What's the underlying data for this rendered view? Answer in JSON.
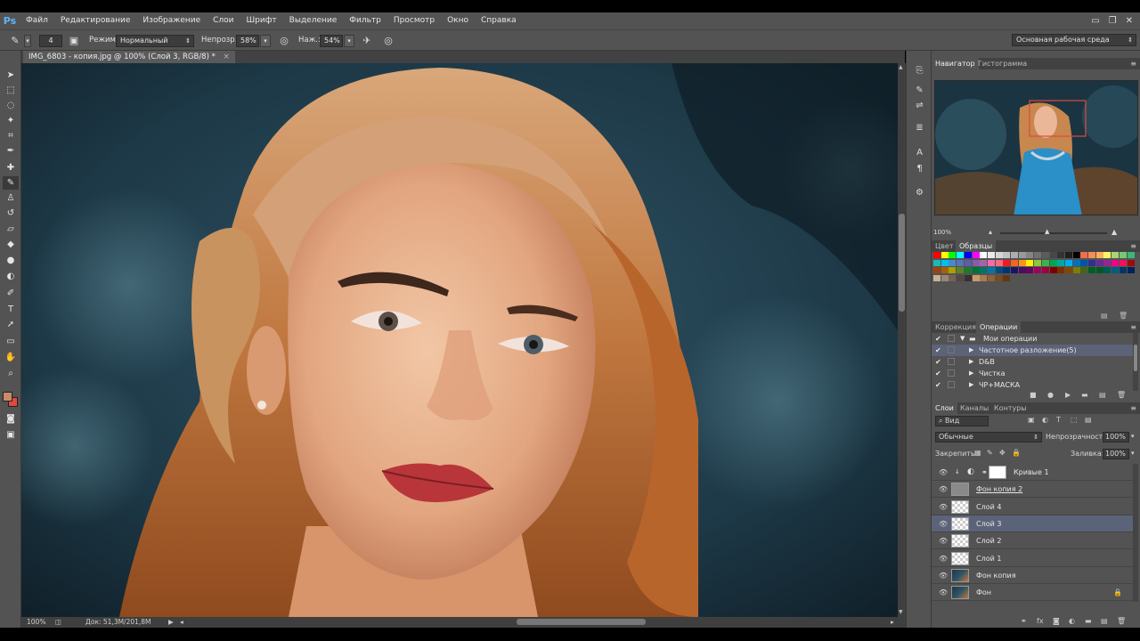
{
  "app": {
    "logo": "Ps"
  },
  "menu": [
    "Файл",
    "Редактирование",
    "Изображение",
    "Слои",
    "Шрифт",
    "Выделение",
    "Фильтр",
    "Просмотр",
    "Окно",
    "Справка"
  ],
  "window_controls": [
    "▭",
    "❐",
    "✕"
  ],
  "options": {
    "brush_size": "4",
    "mode_label": "Режим:",
    "mode_value": "Нормальный",
    "opacity_label": "Непрозр.:",
    "opacity_value": "58%",
    "pressure_label": "Наж.:",
    "pressure_value": "54%",
    "workspace": "Основная рабочая среда"
  },
  "document": {
    "tab_title": "IMG_6803 - копия.jpg @ 100% (Слой 3, RGB/8) *",
    "zoom": "100%",
    "doc_info": "Док: 51,3M/201,8M"
  },
  "navigator": {
    "tabs": [
      "Навигатор",
      "Гистограмма"
    ],
    "zoom": "100%"
  },
  "swatches_panel": {
    "tabs": [
      "Цвет",
      "Образцы"
    ]
  },
  "actions_panel": {
    "tabs": [
      "Коррекция",
      "Операции"
    ],
    "items": [
      {
        "label": "Мои операции",
        "level": 0,
        "folder": true,
        "expanded": true
      },
      {
        "label": "Частотное разложение(5)",
        "level": 1,
        "selected": true
      },
      {
        "label": "D&B",
        "level": 1
      },
      {
        "label": "Чистка",
        "level": 1
      },
      {
        "label": "ЧР+МАСКА",
        "level": 1
      }
    ]
  },
  "layers_panel": {
    "tabs": [
      "Слои",
      "Каналы",
      "Контуры"
    ],
    "filter": "Вид",
    "blend_mode": "Обычные",
    "opacity_label": "Непрозрачность:",
    "opacity_value": "100%",
    "lock_label": "Закрепить:",
    "fill_label": "Заливка:",
    "fill_value": "100%",
    "layers": [
      {
        "name": "Кривые 1",
        "type": "adjustment"
      },
      {
        "name": "Фон копия 2",
        "type": "gray"
      },
      {
        "name": "Слой 4",
        "type": "transparent"
      },
      {
        "name": "Слой 3",
        "type": "transparent",
        "selected": true
      },
      {
        "name": "Слой 2",
        "type": "transparent"
      },
      {
        "name": "Слой 1",
        "type": "transparent"
      },
      {
        "name": "Фон копия",
        "type": "photo"
      },
      {
        "name": "Фон",
        "type": "photo",
        "locked": true
      }
    ]
  },
  "colors": {
    "foreground": "#c98a6a",
    "background": "#e04a3a",
    "selected_row": "#5b6379",
    "panel_bg": "#535353"
  }
}
